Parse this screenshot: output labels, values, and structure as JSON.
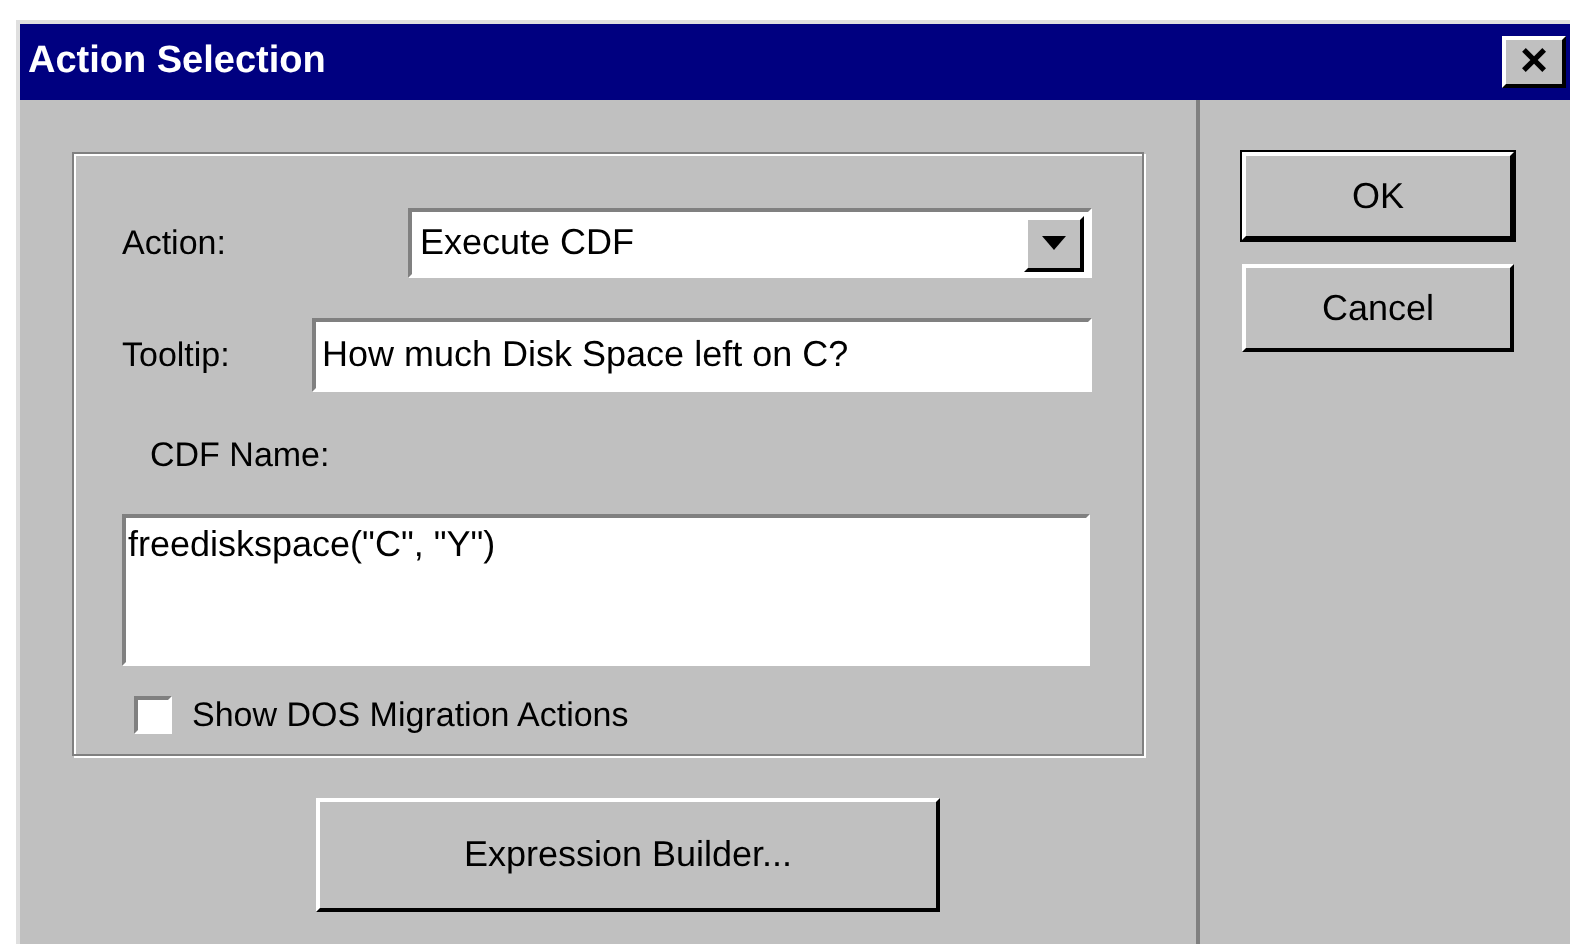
{
  "window": {
    "title": "Action Selection",
    "close": "×"
  },
  "action": {
    "label": "Action:",
    "value": "Execute CDF"
  },
  "tooltip": {
    "label": "Tooltip:",
    "value": "How much Disk Space left on C?"
  },
  "cdf_name": {
    "label": "CDF Name:",
    "value": "freediskspace(\"C\", \"Y\")"
  },
  "show_dos_migration": {
    "label": "Show DOS Migration Actions",
    "checked": false
  },
  "expression_builder": {
    "label": "Expression Builder..."
  },
  "buttons": [
    {
      "label": "OK",
      "default": true
    },
    {
      "label": "Cancel",
      "default": false
    }
  ]
}
